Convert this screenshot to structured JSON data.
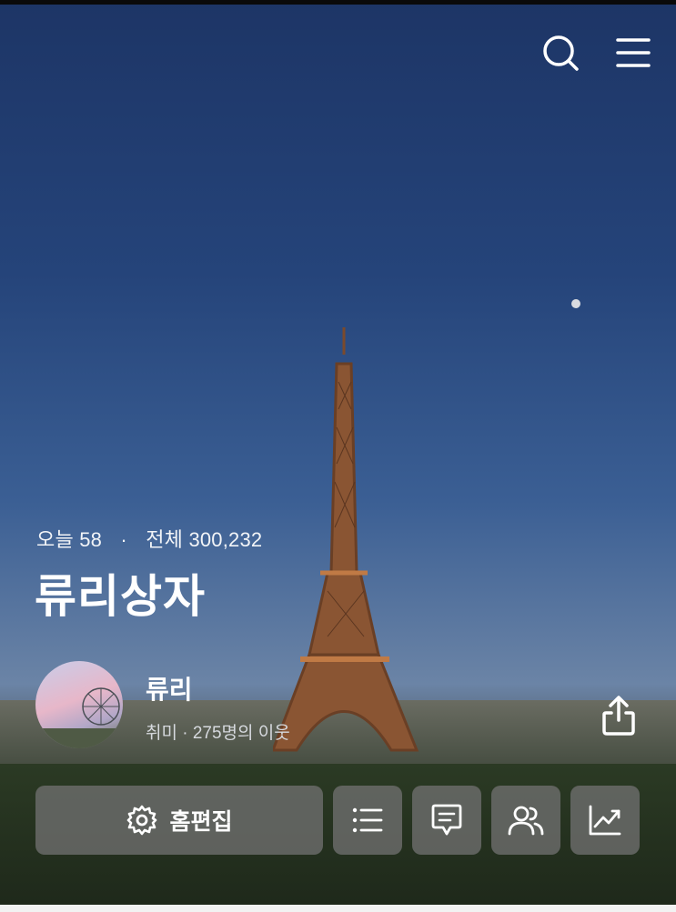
{
  "header": {
    "search_icon": "search-icon",
    "menu_icon": "menu-icon"
  },
  "stats": {
    "today_label": "오늘",
    "today_count": "58",
    "separator": "·",
    "total_label": "전체",
    "total_count": "300,232"
  },
  "blog": {
    "title": "류리상자"
  },
  "profile": {
    "nickname": "류리",
    "meta": "취미 · 275명의 이웃"
  },
  "actions": {
    "edit_home_label": "홈편집",
    "buttons": [
      "settings-icon",
      "list-icon",
      "comment-icon",
      "neighbors-icon",
      "stats-icon",
      "share-icon"
    ]
  },
  "colors": {
    "button_bg": "#707070",
    "text": "#ffffff"
  }
}
